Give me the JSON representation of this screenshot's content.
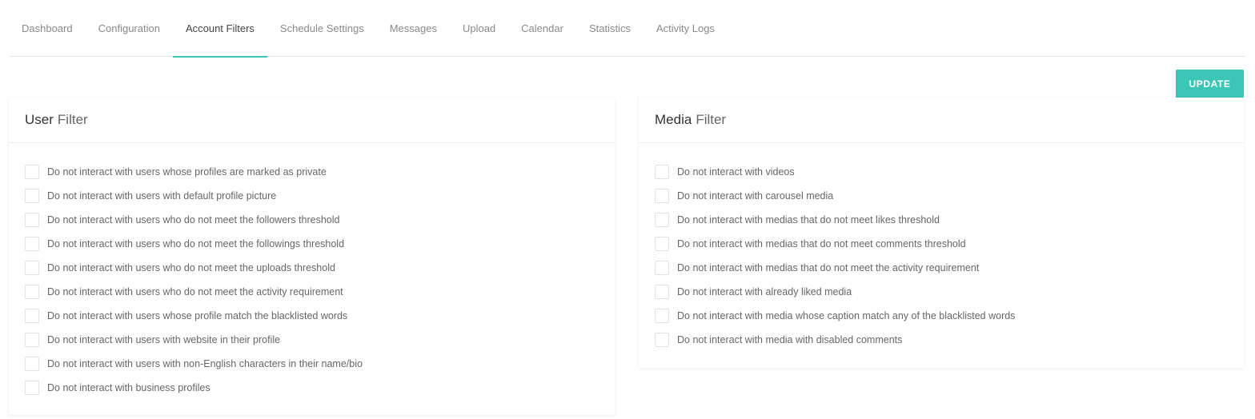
{
  "tabs": [
    {
      "label": "Dashboard",
      "active": false
    },
    {
      "label": "Configuration",
      "active": false
    },
    {
      "label": "Account Filters",
      "active": true
    },
    {
      "label": "Schedule Settings",
      "active": false
    },
    {
      "label": "Messages",
      "active": false
    },
    {
      "label": "Upload",
      "active": false
    },
    {
      "label": "Calendar",
      "active": false
    },
    {
      "label": "Statistics",
      "active": false
    },
    {
      "label": "Activity Logs",
      "active": false
    }
  ],
  "update_label": "UPDATE",
  "accent_color": "#3cc6b6",
  "user_filter": {
    "title_strong": "User",
    "title_rest": "Filter",
    "options": [
      {
        "label": "Do not interact with users whose profiles are marked as private",
        "checked": false
      },
      {
        "label": "Do not interact with users with default profile picture",
        "checked": false
      },
      {
        "label": "Do not interact with users who do not meet the followers threshold",
        "checked": false
      },
      {
        "label": "Do not interact with users who do not meet the followings threshold",
        "checked": false
      },
      {
        "label": "Do not interact with users who do not meet the uploads threshold",
        "checked": false
      },
      {
        "label": "Do not interact with users who do not meet the activity requirement",
        "checked": false
      },
      {
        "label": "Do not interact with users whose profile match the blacklisted words",
        "checked": false
      },
      {
        "label": "Do not interact with users with website in their profile",
        "checked": false
      },
      {
        "label": "Do not interact with users with non-English characters in their name/bio",
        "checked": false
      },
      {
        "label": "Do not interact with business profiles",
        "checked": false
      }
    ]
  },
  "media_filter": {
    "title_strong": "Media",
    "title_rest": "Filter",
    "options": [
      {
        "label": "Do not interact with videos",
        "checked": false
      },
      {
        "label": "Do not interact with carousel media",
        "checked": false
      },
      {
        "label": "Do not interact with medias that do not meet likes threshold",
        "checked": false
      },
      {
        "label": "Do not interact with medias that do not meet comments threshold",
        "checked": false
      },
      {
        "label": "Do not interact with medias that do not meet the activity requirement",
        "checked": false
      },
      {
        "label": "Do not interact with already liked media",
        "checked": false
      },
      {
        "label": "Do not interact with media whose caption match any of the blacklisted words",
        "checked": false
      },
      {
        "label": "Do not interact with media with disabled comments",
        "checked": false
      }
    ]
  }
}
